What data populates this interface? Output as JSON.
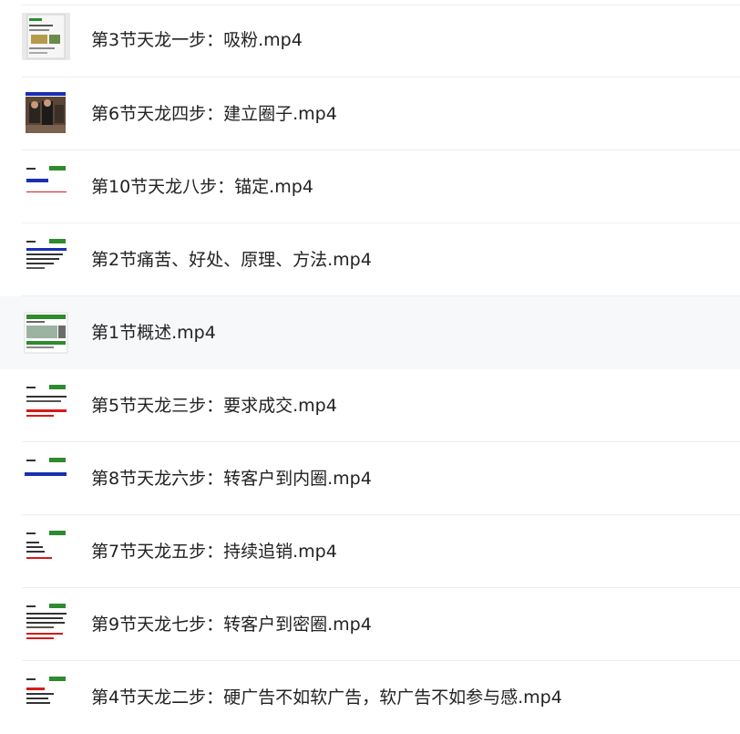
{
  "files": [
    {
      "name": "第3节天龙一步：吸粉.mp4",
      "thumb_icon": "video-thumbnail-icon",
      "selected": false
    },
    {
      "name": "第6节天龙四步：建立圈子.mp4",
      "thumb_icon": "video-thumbnail-icon",
      "selected": false
    },
    {
      "name": "第10节天龙八步：锚定.mp4",
      "thumb_icon": "video-thumbnail-icon",
      "selected": false
    },
    {
      "name": "第2节痛苦、好处、原理、方法.mp4",
      "thumb_icon": "video-thumbnail-icon",
      "selected": false
    },
    {
      "name": "第1节概述.mp4",
      "thumb_icon": "video-thumbnail-icon",
      "selected": true
    },
    {
      "name": "第5节天龙三步：要求成交.mp4",
      "thumb_icon": "video-thumbnail-icon",
      "selected": false
    },
    {
      "name": "第8节天龙六步：转客户到内圈.mp4",
      "thumb_icon": "video-thumbnail-icon",
      "selected": false
    },
    {
      "name": "第7节天龙五步：持续追销.mp4",
      "thumb_icon": "video-thumbnail-icon",
      "selected": false
    },
    {
      "name": "第9节天龙七步：转客户到密圈.mp4",
      "thumb_icon": "video-thumbnail-icon",
      "selected": false
    },
    {
      "name": "第4节天龙二步：硬广告不如软广告，软广告不如参与感.mp4",
      "thumb_icon": "video-thumbnail-icon",
      "selected": false
    }
  ],
  "colors": {
    "selected_row_bg": "#f7f8fa",
    "divider": "#eeeeee",
    "text": "#222222",
    "thumb_green": "#2e8b2e",
    "thumb_blue": "#1a2fb0",
    "thumb_red": "#d61a1a"
  }
}
